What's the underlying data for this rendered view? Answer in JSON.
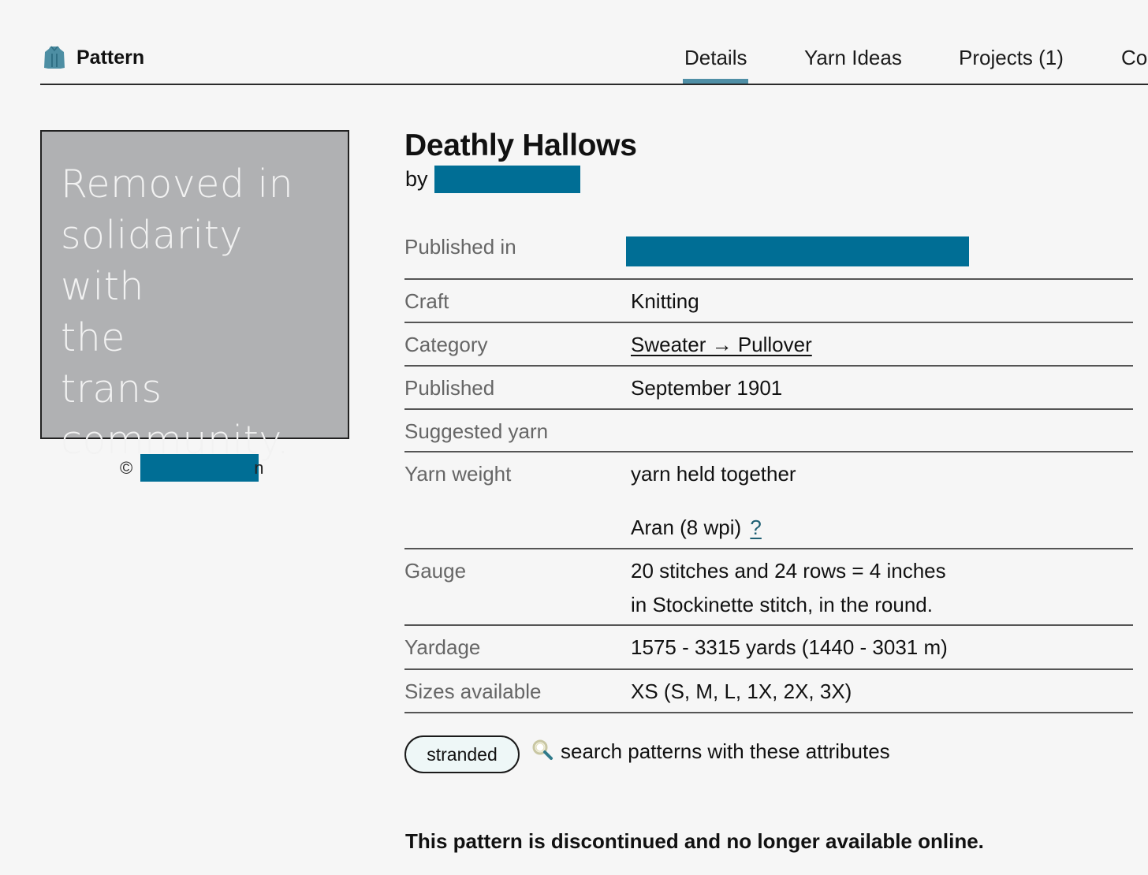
{
  "header": {
    "section_title": "Pattern",
    "tabs": [
      {
        "label": "Details",
        "active": true
      },
      {
        "label": "Yarn Ideas",
        "active": false
      },
      {
        "label": "Projects (1)",
        "active": false
      },
      {
        "label": "Co",
        "active": false
      }
    ]
  },
  "image": {
    "placeholder_lines": [
      "Removed in",
      "solidarity with",
      "the",
      "trans",
      "community."
    ],
    "credit_symbol": "©",
    "credit_tail": "n"
  },
  "pattern": {
    "title": "Deathly Hallows",
    "by_label": "by"
  },
  "details": {
    "published_in": {
      "label": "Published in"
    },
    "craft": {
      "label": "Craft",
      "value": "Knitting"
    },
    "category": {
      "label": "Category",
      "value": "Sweater → Pullover"
    },
    "published": {
      "label": "Published",
      "value": "September 1901"
    },
    "suggested_yarn": {
      "label": "Suggested yarn",
      "value": ""
    },
    "yarn_weight": {
      "label": "Yarn weight",
      "value_line1": "yarn held together",
      "value_line2": "Aran (8 wpi)",
      "help_link": "?"
    },
    "gauge": {
      "label": "Gauge",
      "value_line1": "20 stitches and 24 rows = 4 inches",
      "value_line2": "in Stockinette stitch, in the round."
    },
    "yardage": {
      "label": "Yardage",
      "value": "1575 - 3315 yards (1440 - 3031 m)"
    },
    "sizes": {
      "label": "Sizes available",
      "value": "XS (S, M, L, 1X, 2X, 3X)"
    }
  },
  "attributes": {
    "tags": [
      "stranded"
    ],
    "search_label": "search patterns with these attributes"
  },
  "notice": "This pattern is discontinued and no longer available online.",
  "colors": {
    "redaction": "#006e95",
    "tab_underline": "#4f8fa6",
    "link": "#1f5f73",
    "pill_bg": "#eef7f7"
  }
}
